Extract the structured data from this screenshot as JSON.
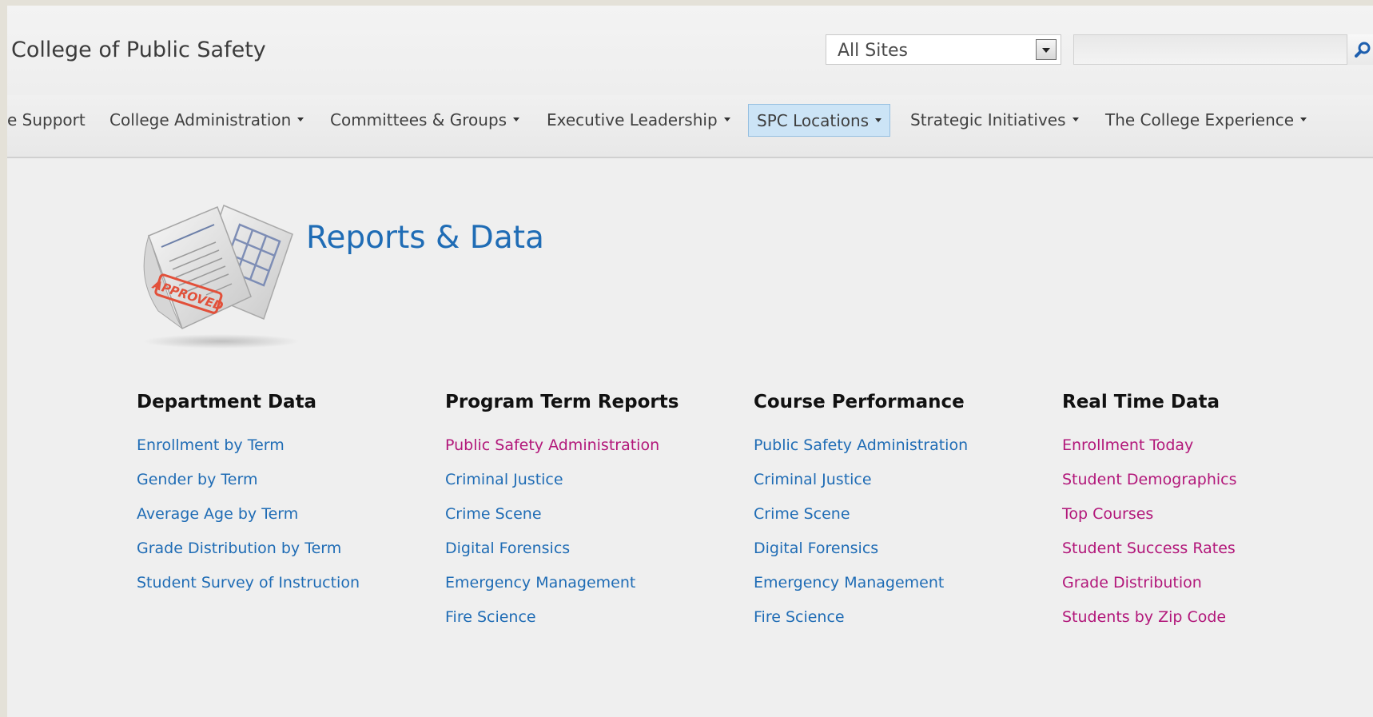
{
  "header": {
    "site_title": "College of Public Safety",
    "scope": {
      "selected": "All Sites"
    },
    "search": {
      "value": "",
      "placeholder": "",
      "icon": "search-icon"
    }
  },
  "nav": {
    "items": [
      {
        "label": "e Support",
        "has_dropdown": false
      },
      {
        "label": "College Administration",
        "has_dropdown": true
      },
      {
        "label": "Committees & Groups",
        "has_dropdown": true
      },
      {
        "label": "Executive Leadership",
        "has_dropdown": true
      },
      {
        "label": "SPC Locations",
        "has_dropdown": true,
        "selected": true
      },
      {
        "label": "Strategic Initiatives",
        "has_dropdown": true
      },
      {
        "label": "The College Experience",
        "has_dropdown": true
      }
    ]
  },
  "page": {
    "title": "Reports & Data",
    "icon": "reports-document-icon",
    "icon_stamp_text": "APPROVED"
  },
  "sections": [
    {
      "heading": "Department Data",
      "link_color": "#1f6cb5",
      "links": [
        "Enrollment by Term",
        "Gender by Term",
        "Average Age by Term",
        "Grade Distribution by Term",
        "Student Survey of Instruction"
      ]
    },
    {
      "heading": "Program Term Reports",
      "link_colors": [
        "#b2177a",
        "#1f6cb5"
      ],
      "links": [
        "Public Safety Administration",
        "Criminal Justice",
        "Crime Scene",
        "Digital Forensics",
        "Emergency Management",
        "Fire Science"
      ]
    },
    {
      "heading": "Course Performance",
      "link_color": "#1f6cb5",
      "links": [
        "Public Safety Administration",
        "Criminal Justice",
        "Crime Scene",
        "Digital Forensics",
        "Emergency Management",
        "Fire Science"
      ]
    },
    {
      "heading": "Real Time Data",
      "link_color": "#b2177a",
      "links": [
        "Enrollment Today",
        "Student Demographics",
        "Top Courses",
        "Student Success Rates",
        "Grade Distribution",
        "Students by Zip Code"
      ]
    }
  ]
}
